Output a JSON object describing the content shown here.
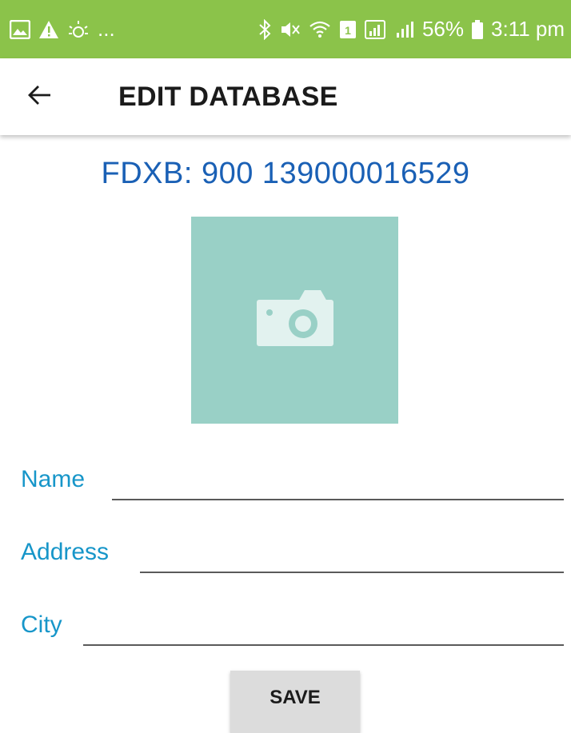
{
  "status_bar": {
    "left_icons": [
      "gallery-icon",
      "warning-icon",
      "brightness-icon"
    ],
    "ellipsis": "...",
    "right_icons": [
      "bluetooth-icon",
      "mute-icon",
      "wifi-icon",
      "sim-icon",
      "signal-icon",
      "signal-r-icon"
    ],
    "battery": "56%",
    "time": "3:11 pm",
    "background_color": "#8bc34a"
  },
  "app_bar": {
    "back_icon": "arrow-left-icon",
    "title": "EDIT DATABASE"
  },
  "tag": {
    "id_text": "FDXB: 900 139000016529",
    "color": "#1a60b5"
  },
  "photo": {
    "icon": "camera-icon",
    "background_color": "#99d0c6"
  },
  "form": {
    "name_label": "Name",
    "name_value": "",
    "address_label": "Address",
    "address_value": "",
    "city_label": "City",
    "city_value": "",
    "label_color": "#1796c9"
  },
  "save_button": {
    "label": "SAVE"
  }
}
